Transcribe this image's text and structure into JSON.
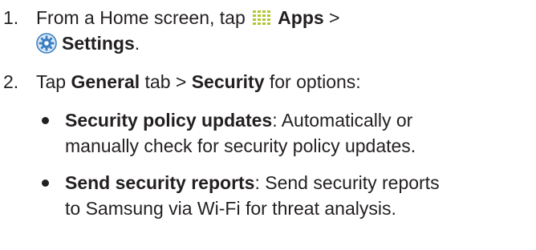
{
  "steps": [
    {
      "number": "1.",
      "line1_prefix": "From a Home screen, tap ",
      "apps_label": "Apps",
      "line1_suffix": " >",
      "settings_label": "Settings",
      "line2_suffix": "."
    },
    {
      "number": "2.",
      "prefix": "Tap ",
      "general_label": "General",
      "middle": " tab > ",
      "security_label": "Security",
      "suffix": " for options:"
    }
  ],
  "bullets": [
    {
      "term": "Security policy updates",
      "line1_rest": ": Automatically or",
      "line2": "manually check for security policy updates."
    },
    {
      "term": "Send security reports",
      "line1_rest": ": Send security reports",
      "line2": "to Samsung via Wi-Fi for threat analysis."
    }
  ],
  "icons": {
    "apps": "apps-grid-icon",
    "settings": "settings-gear-icon"
  },
  "colors": {
    "text": "#231f20",
    "apps_icon": "#b5c634",
    "settings_icon": "#3a7fc1"
  }
}
